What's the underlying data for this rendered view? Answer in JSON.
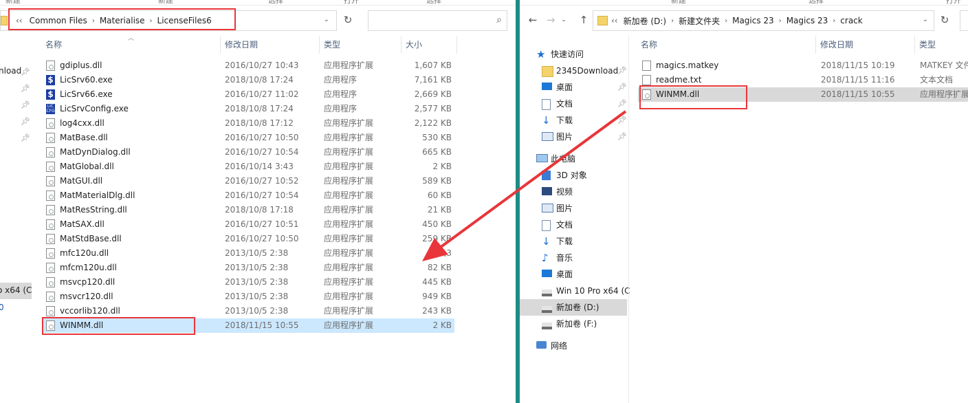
{
  "left": {
    "ribbon": [
      "新建",
      "新建",
      "选择",
      "打开",
      "选择"
    ],
    "address": {
      "back": "‹‹",
      "crumbs": [
        "Common Files",
        "Materialise",
        "LicenseFiles6"
      ],
      "refresh": "↻"
    },
    "nav_fragments": [
      "nload",
      "o x64 (C",
      "0"
    ],
    "columns": {
      "name": "名称",
      "date": "修改日期",
      "type": "类型",
      "size": "大小"
    },
    "files": [
      {
        "name": "gdiplus.dll",
        "date": "2016/10/27 10:43",
        "type": "应用程序扩展",
        "size": "1,607 KB",
        "icon": "dll-file-icon"
      },
      {
        "name": "LicSrv60.exe",
        "date": "2018/10/8 17:24",
        "type": "应用程序",
        "size": "7,161 KB",
        "icon": "exe-s-icon"
      },
      {
        "name": "LicSrv66.exe",
        "date": "2016/10/27 11:02",
        "type": "应用程序",
        "size": "2,669 KB",
        "icon": "exe-s-icon"
      },
      {
        "name": "LicSrvConfig.exe",
        "date": "2018/10/8 17:24",
        "type": "应用程序",
        "size": "2,577 KB",
        "icon": "exe-config-icon"
      },
      {
        "name": "log4cxx.dll",
        "date": "2018/10/8 17:12",
        "type": "应用程序扩展",
        "size": "2,122 KB",
        "icon": "dll-file-icon"
      },
      {
        "name": "MatBase.dll",
        "date": "2016/10/27 10:50",
        "type": "应用程序扩展",
        "size": "530 KB",
        "icon": "dll-file-icon"
      },
      {
        "name": "MatDynDialog.dll",
        "date": "2016/10/27 10:54",
        "type": "应用程序扩展",
        "size": "665 KB",
        "icon": "dll-file-icon"
      },
      {
        "name": "MatGlobal.dll",
        "date": "2016/10/14 3:43",
        "type": "应用程序扩展",
        "size": "2 KB",
        "icon": "dll-file-icon"
      },
      {
        "name": "MatGUI.dll",
        "date": "2016/10/27 10:52",
        "type": "应用程序扩展",
        "size": "589 KB",
        "icon": "dll-file-icon"
      },
      {
        "name": "MatMaterialDlg.dll",
        "date": "2016/10/27 10:54",
        "type": "应用程序扩展",
        "size": "60 KB",
        "icon": "dll-file-icon"
      },
      {
        "name": "MatResString.dll",
        "date": "2018/10/8 17:18",
        "type": "应用程序扩展",
        "size": "21 KB",
        "icon": "dll-file-icon"
      },
      {
        "name": "MatSAX.dll",
        "date": "2016/10/27 10:51",
        "type": "应用程序扩展",
        "size": "450 KB",
        "icon": "dll-file-icon"
      },
      {
        "name": "MatStdBase.dll",
        "date": "2016/10/27 10:50",
        "type": "应用程序扩展",
        "size": "259 KB",
        "icon": "dll-file-icon"
      },
      {
        "name": "mfc120u.dll",
        "date": "2013/10/5 2:38",
        "type": "应用程序扩展",
        "size": "4,3",
        "icon": "dll-file-icon"
      },
      {
        "name": "mfcm120u.dll",
        "date": "2013/10/5 2:38",
        "type": "应用程序扩展",
        "size": "82 KB",
        "icon": "dll-file-icon"
      },
      {
        "name": "msvcp120.dll",
        "date": "2013/10/5 2:38",
        "type": "应用程序扩展",
        "size": "445 KB",
        "icon": "dll-file-icon"
      },
      {
        "name": "msvcr120.dll",
        "date": "2013/10/5 2:38",
        "type": "应用程序扩展",
        "size": "949 KB",
        "icon": "dll-file-icon"
      },
      {
        "name": "vccorlib120.dll",
        "date": "2013/10/5 2:38",
        "type": "应用程序扩展",
        "size": "243 KB",
        "icon": "dll-file-icon"
      },
      {
        "name": "WINMM.dll",
        "date": "2018/11/15 10:55",
        "type": "应用程序扩展",
        "size": "2 KB",
        "icon": "dll-file-icon",
        "selected": true
      }
    ]
  },
  "right": {
    "ribbon": [
      "新建",
      "选择",
      "打开"
    ],
    "address": {
      "back": "‹‹",
      "crumbs": [
        "新加卷 (D:)",
        "新建文件夹",
        "Magics 23",
        "Magics 23",
        "crack"
      ],
      "refresh": "↻"
    },
    "columns": {
      "name": "名称",
      "date": "修改日期",
      "type": "类型"
    },
    "nav": [
      {
        "label": "快速访问",
        "icon": "star-icon",
        "indent": 0
      },
      {
        "label": "2345Download",
        "icon": "folder-icon",
        "indent": 1,
        "pinned": true
      },
      {
        "label": "桌面",
        "icon": "desktop-icon",
        "indent": 1,
        "pinned": true
      },
      {
        "label": "文档",
        "icon": "document-icon",
        "indent": 1,
        "pinned": true
      },
      {
        "label": "下载",
        "icon": "download-icon",
        "indent": 1,
        "pinned": true
      },
      {
        "label": "图片",
        "icon": "picture-icon",
        "indent": 1,
        "pinned": true
      },
      {
        "label": "此电脑",
        "icon": "computer-icon",
        "indent": 0
      },
      {
        "label": "3D 对象",
        "icon": "cube-icon",
        "indent": 1
      },
      {
        "label": "视频",
        "icon": "video-icon",
        "indent": 1
      },
      {
        "label": "图片",
        "icon": "picture-icon",
        "indent": 1
      },
      {
        "label": "文档",
        "icon": "document-icon",
        "indent": 1
      },
      {
        "label": "下载",
        "icon": "download-icon",
        "indent": 1
      },
      {
        "label": "音乐",
        "icon": "music-icon",
        "indent": 1
      },
      {
        "label": "桌面",
        "icon": "desktop-icon",
        "indent": 1
      },
      {
        "label": "Win 10 Pro x64 (C",
        "icon": "drive-icon",
        "indent": 1
      },
      {
        "label": "新加卷 (D:)",
        "icon": "drive-icon",
        "indent": 1,
        "selected": true
      },
      {
        "label": "新加卷 (F:)",
        "icon": "drive-icon",
        "indent": 1
      },
      {
        "label": "网络",
        "icon": "network-icon",
        "indent": 0
      }
    ],
    "files": [
      {
        "name": "magics.matkey",
        "date": "2018/11/15 10:19",
        "type": "MATKEY 文件",
        "icon": "file-icon"
      },
      {
        "name": "readme.txt",
        "date": "2018/11/15 11:16",
        "type": "文本文档",
        "icon": "text-file-icon"
      },
      {
        "name": "WINMM.dll",
        "date": "2018/11/15 10:55",
        "type": "应用程序扩展",
        "icon": "dll-file-icon",
        "highlighted": true
      }
    ]
  },
  "colors": {
    "annotation_red": "#e8363a",
    "selection_blue": "#cce8ff",
    "divider_teal": "#1e8c86"
  }
}
